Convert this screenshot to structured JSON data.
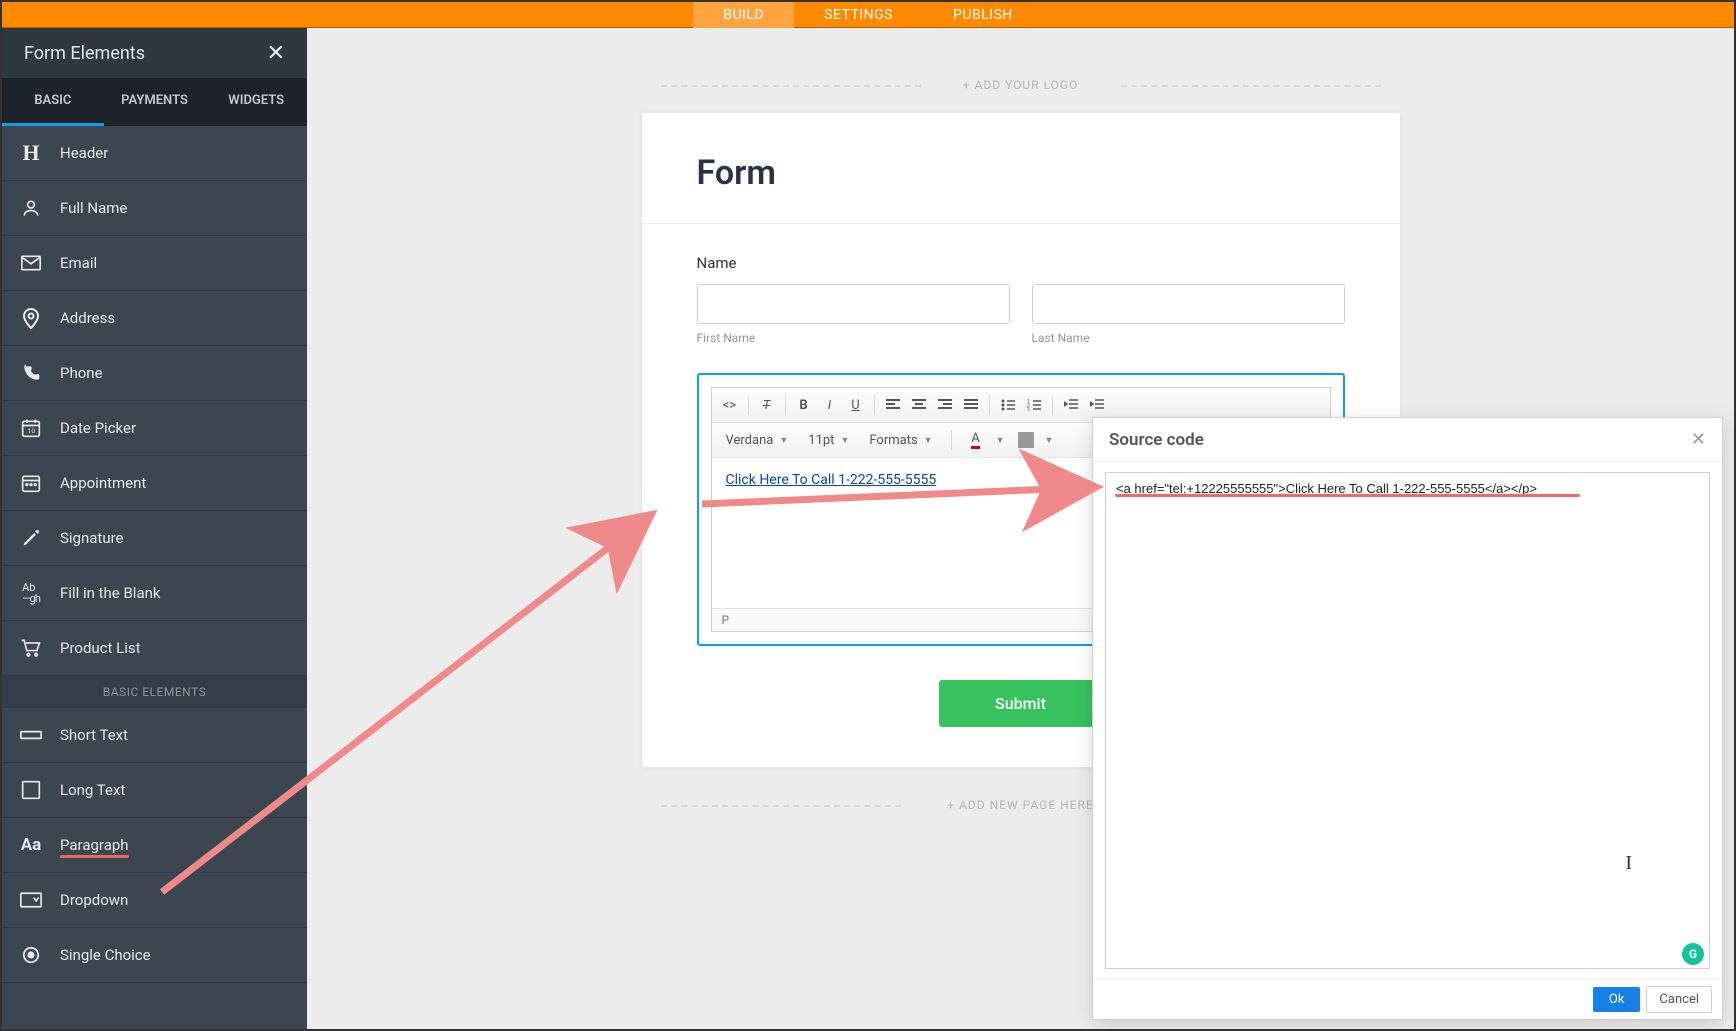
{
  "topnav": {
    "build": "BUILD",
    "settings": "SETTINGS",
    "publish": "PUBLISH"
  },
  "sidebar": {
    "title": "Form Elements",
    "tabs": {
      "basic": "BASIC",
      "payments": "PAYMENTS",
      "widgets": "WIDGETS"
    },
    "items": [
      {
        "label": "Header",
        "icon": "H"
      },
      {
        "label": "Full Name",
        "icon": "◯"
      },
      {
        "label": "Email",
        "icon": "✉"
      },
      {
        "label": "Address",
        "icon": "📍"
      },
      {
        "label": "Phone",
        "icon": "☎"
      },
      {
        "label": "Date Picker",
        "icon": "📅"
      },
      {
        "label": "Appointment",
        "icon": "🗓"
      },
      {
        "label": "Signature",
        "icon": "✎"
      },
      {
        "label": "Fill in the Blank",
        "icon": "Ab"
      },
      {
        "label": "Product List",
        "icon": "🛒"
      }
    ],
    "section_label": "BASIC ELEMENTS",
    "items2": [
      {
        "label": "Short Text",
        "icon": "▭"
      },
      {
        "label": "Long Text",
        "icon": "▢"
      },
      {
        "label": "Paragraph",
        "icon": "Aa",
        "highlight": true
      },
      {
        "label": "Dropdown",
        "icon": "≡"
      },
      {
        "label": "Single Choice",
        "icon": "◉"
      }
    ]
  },
  "canvas": {
    "add_logo": "+ ADD YOUR LOGO",
    "add_page": "+ ADD NEW PAGE HERE",
    "form_title": "Form",
    "name_label": "Name",
    "first_name": "First Name",
    "last_name": "Last Name",
    "submit": "Submit"
  },
  "rte": {
    "font": "Verdana",
    "size": "11pt",
    "formats": "Formats",
    "link_text": "Click Here To Call 1-222-555-5555",
    "status": "P",
    "text_color_label": "A"
  },
  "dialog": {
    "title": "Source code",
    "code": "<a href=\"tel:+12225555555\">Click Here To Call 1-222-555-5555</a></p>",
    "ok": "Ok",
    "cancel": "Cancel"
  }
}
